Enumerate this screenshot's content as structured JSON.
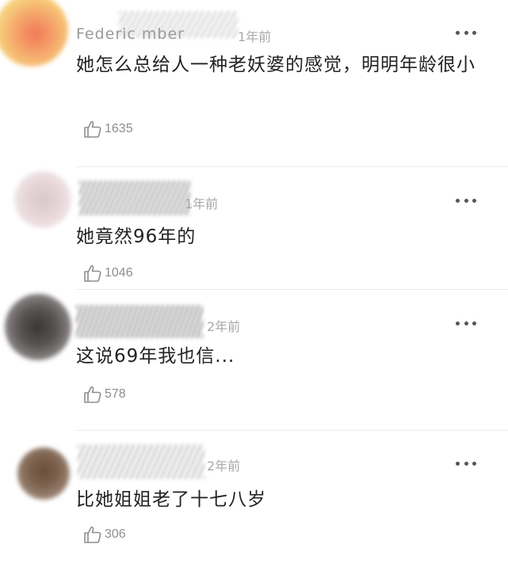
{
  "comments": [
    {
      "username": "Federic     mber",
      "time": "1年前",
      "content": "她怎么总给人一种老妖婆的感觉，明明年龄很小",
      "likes": "1635",
      "like_icon": "thumbs-up-icon",
      "more_icon": "more-dots-icon"
    },
    {
      "username": "",
      "time": "1年前",
      "content": "她竟然96年的",
      "likes": "1046",
      "like_icon": "thumbs-up-icon",
      "more_icon": "more-dots-icon"
    },
    {
      "username": "",
      "time": "2年前",
      "content": "这说69年我也信...",
      "likes": "578",
      "like_icon": "thumbs-up-icon",
      "more_icon": "more-dots-icon"
    },
    {
      "username": "",
      "time": "2年前",
      "content": "比她姐姐老了十七八岁",
      "likes": "306",
      "like_icon": "thumbs-up-icon",
      "more_icon": "more-dots-icon"
    }
  ]
}
